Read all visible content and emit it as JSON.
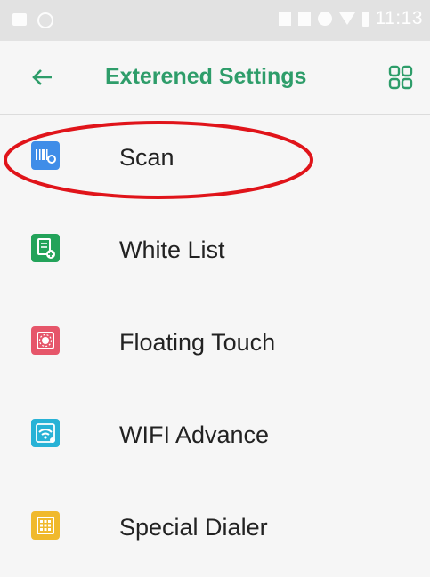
{
  "status_bar": {
    "time": "11:13"
  },
  "header": {
    "title": "Exterened Settings",
    "back_icon": "arrow-left-icon",
    "menu_icon": "grid-icon"
  },
  "colors": {
    "accent": "#2e9d6a",
    "highlight": "#e0141a"
  },
  "items": [
    {
      "label": "Scan",
      "icon": "scan-icon",
      "color": "#3f8de8"
    },
    {
      "label": "White List",
      "icon": "white-list-icon",
      "color": "#23a35a"
    },
    {
      "label": "Floating Touch",
      "icon": "floating-touch-icon",
      "color": "#e6566a"
    },
    {
      "label": "WIFI Advance",
      "icon": "wifi-advance-icon",
      "color": "#27b2d6"
    },
    {
      "label": "Special Dialer",
      "icon": "special-dialer-icon",
      "color": "#f0b92c"
    }
  ]
}
